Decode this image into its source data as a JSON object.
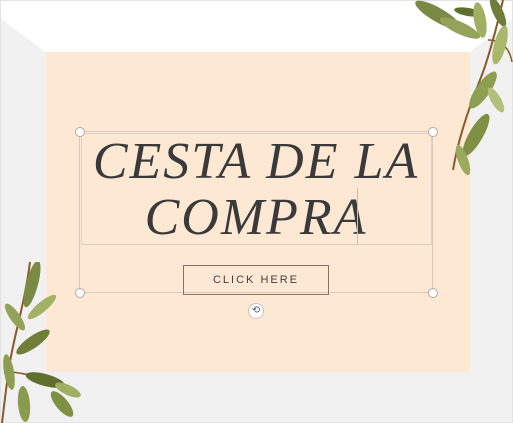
{
  "canvas": {
    "card_color": "#fde8d3",
    "backdrop_color": "#f1f1f1",
    "title": "CESTA DE LA COMPRA",
    "button_label": "CLICK HERE",
    "rotate_glyph": "⟲"
  },
  "colors": {
    "leaf_dark": "#6f7f3a",
    "leaf_light": "#a9b86a",
    "stem": "#8a5a2b",
    "button_border": "#8a6e68",
    "title_color": "#3a3a3a"
  },
  "icons": [
    "rotate-icon",
    "leaf-decoration-top-right",
    "leaf-decoration-bottom-left"
  ]
}
